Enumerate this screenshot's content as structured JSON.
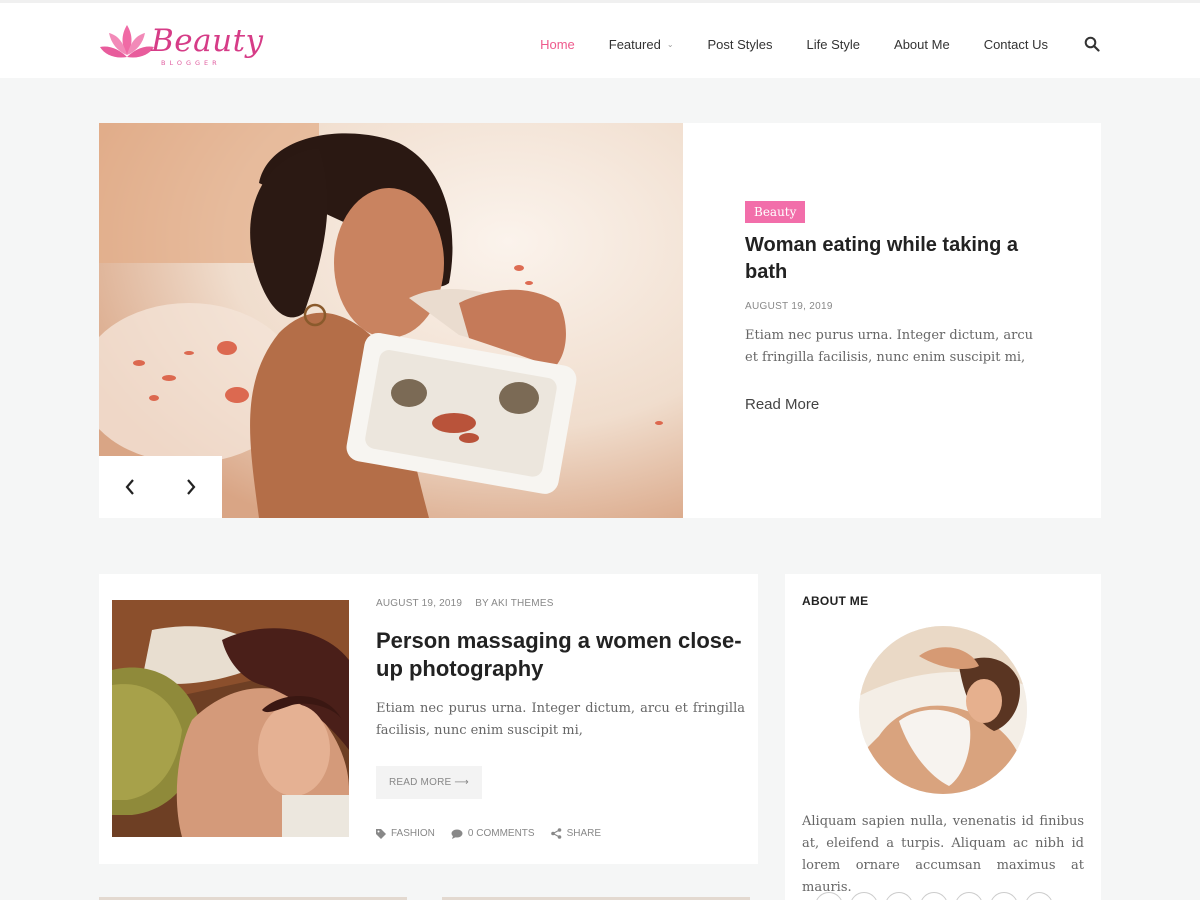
{
  "brand": {
    "name": "Beauty",
    "tagline": "BLOGGER",
    "color": "#d63c87"
  },
  "nav": {
    "items": [
      {
        "label": "Home",
        "active": true
      },
      {
        "label": "Featured",
        "has_dropdown": true
      },
      {
        "label": "Post Styles"
      },
      {
        "label": "Life Style"
      },
      {
        "label": "About Me"
      },
      {
        "label": "Contact Us"
      }
    ],
    "search_icon": "search-icon",
    "active_color": "#ee5a8c"
  },
  "hero": {
    "category": "Beauty",
    "title": "Woman eating while taking a bath",
    "date": "AUGUST 19, 2019",
    "excerpt": "Etiam nec purus urna. Integer dictum, arcu et fringilla facilisis, nunc enim suscipit mi,",
    "read_more": "Read More",
    "prev_icon": "chevron-left-icon",
    "next_icon": "chevron-right-icon",
    "badge_color": "#f26eaa"
  },
  "post": {
    "date": "AUGUST 19, 2019",
    "author": "BY AKI THEMES",
    "title": "Person massaging a women close-up photography",
    "excerpt": "Etiam nec purus urna. Integer dictum, arcu et fringilla facilisis, nunc enim suscipit mi,",
    "read_more": "READ MORE ⟶",
    "category": "FASHION",
    "comments": "0 COMMENTS",
    "share": "SHARE"
  },
  "sidebar": {
    "widget_title": "ABOUT ME",
    "about_text": "Aliquam sapien nulla, venenatis id finibus at, eleifend a turpis. Aliquam ac nibh id lorem ornare accumsan maximus at mauris."
  }
}
